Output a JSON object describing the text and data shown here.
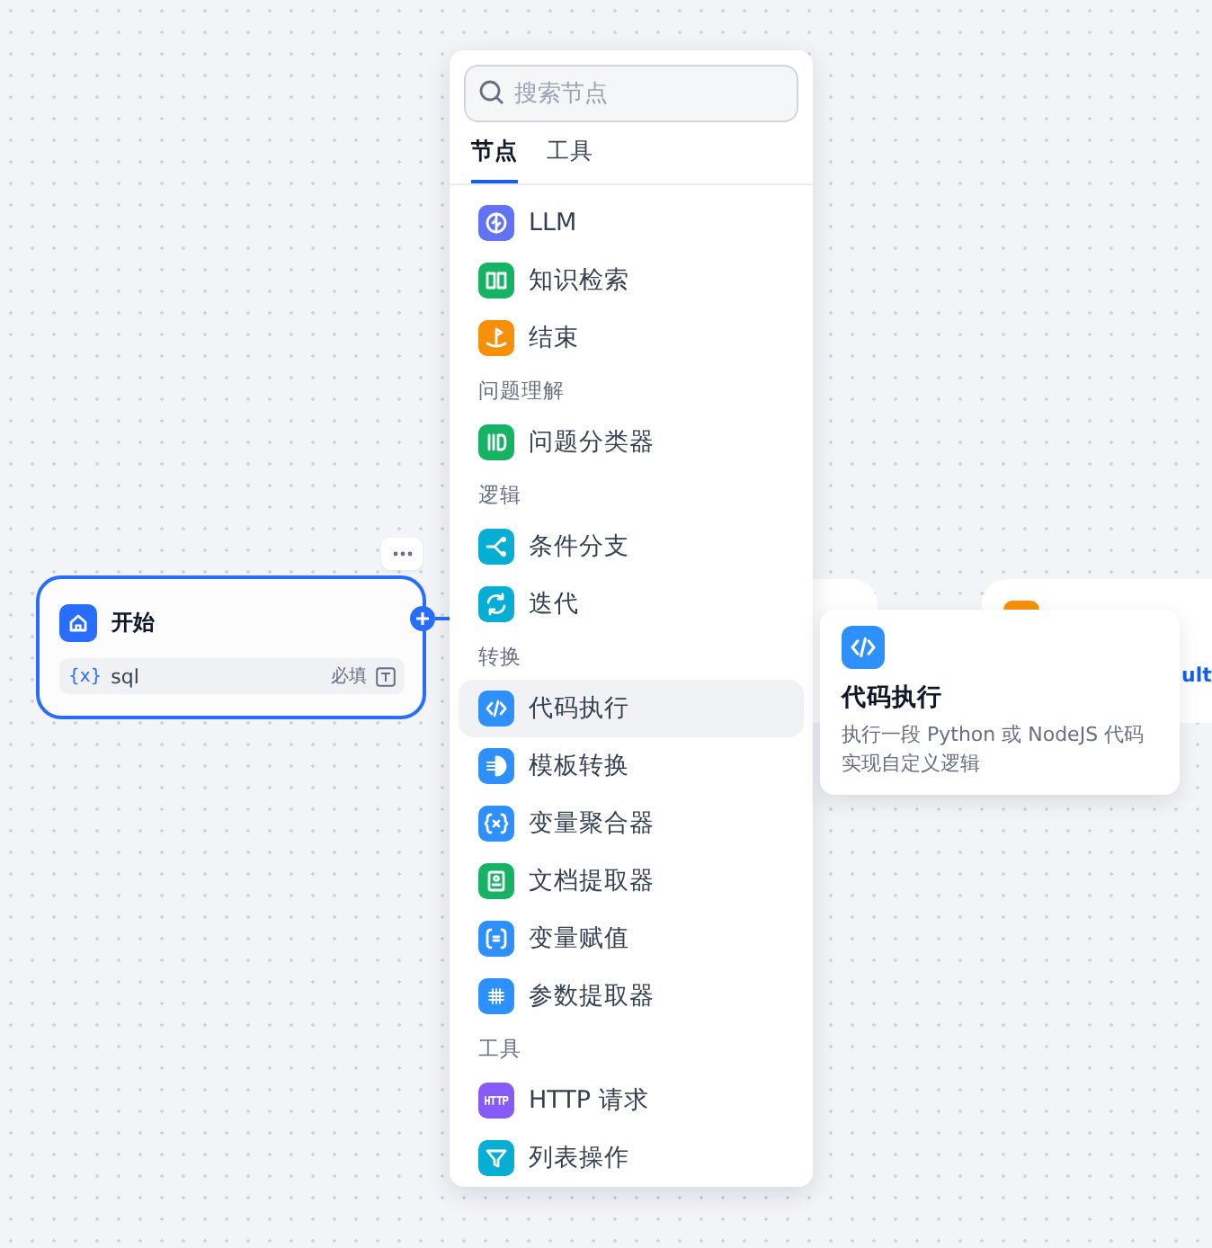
{
  "start_node": {
    "title": "开始",
    "variables": [
      {
        "prefix": "{x}",
        "name": "sql",
        "required": "必填"
      }
    ]
  },
  "hidden_node": {
    "fragment": "ult"
  },
  "node_menu": {
    "search": {
      "placeholder": "搜索节点"
    },
    "tabs": [
      {
        "label": "节点",
        "selected": true
      },
      {
        "label": "工具",
        "selected": false
      }
    ],
    "sections": [
      {
        "items": [
          {
            "label": "LLM",
            "kind": "llm",
            "color": "#6172f3",
            "selected": false
          },
          {
            "label": "知识检索",
            "kind": "book",
            "color": "#16b364",
            "selected": false
          },
          {
            "label": "结束",
            "kind": "flag",
            "color": "#f79009",
            "selected": false
          }
        ]
      },
      {
        "heading": "问题理解",
        "items": [
          {
            "label": "问题分类器",
            "kind": "classify",
            "color": "#16b364",
            "selected": false
          }
        ]
      },
      {
        "heading": "逻辑",
        "items": [
          {
            "label": "条件分支",
            "kind": "branch",
            "color": "#06aed4",
            "selected": false
          },
          {
            "label": "迭代",
            "kind": "loop",
            "color": "#06aed4",
            "selected": false
          }
        ]
      },
      {
        "heading": "转换",
        "items": [
          {
            "label": "代码执行",
            "kind": "code",
            "color": "#2e90fa",
            "selected": true
          },
          {
            "label": "模板转换",
            "kind": "template",
            "color": "#2e90fa",
            "selected": false
          },
          {
            "label": "变量聚合器",
            "kind": "variable",
            "color": "#2e90fa",
            "selected": false
          },
          {
            "label": "文档提取器",
            "kind": "doc",
            "color": "#16b364",
            "selected": false
          },
          {
            "label": "变量赋值",
            "kind": "assign",
            "color": "#2e90fa",
            "selected": false
          },
          {
            "label": "参数提取器",
            "kind": "grid",
            "color": "#2e90fa",
            "selected": false
          }
        ]
      },
      {
        "heading": "工具",
        "items": [
          {
            "label": "HTTP 请求",
            "kind": "http",
            "color": "#875bf7",
            "selected": false
          },
          {
            "label": "列表操作",
            "kind": "filter",
            "color": "#06aed4",
            "selected": false
          }
        ]
      }
    ]
  },
  "tooltip": {
    "title": "代码执行",
    "description": "执行一段 Python 或 NodeJS 代码实现自定义逻辑"
  }
}
